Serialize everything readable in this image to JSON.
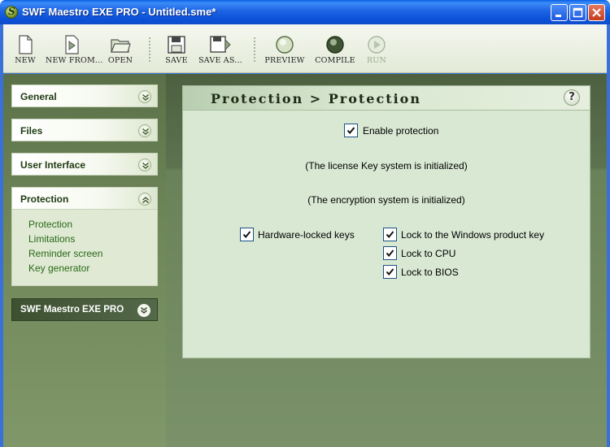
{
  "window": {
    "title": "SWF Maestro EXE PRO - Untitled.sme*",
    "accent": "#0b50d8"
  },
  "toolbar": {
    "new": "NEW",
    "new_from": "NEW FROM...",
    "open": "OPEN",
    "save": "SAVE",
    "save_as": "SAVE AS...",
    "preview": "PREVIEW",
    "compile": "COMPILE",
    "run": "RUN"
  },
  "sidebar": {
    "sections": [
      {
        "label": "General",
        "expanded": false
      },
      {
        "label": "Files",
        "expanded": false
      },
      {
        "label": "User Interface",
        "expanded": false
      },
      {
        "label": "Protection",
        "expanded": true
      }
    ],
    "protection_items": [
      "Protection",
      "Limitations",
      "Reminder screen",
      "Key generator"
    ],
    "brand": "SWF Maestro EXE PRO"
  },
  "panel": {
    "title": "Protection > Protection",
    "help": "?",
    "enable_protection": "Enable protection",
    "license_status": "(The license Key system is initialized)",
    "encryption_status": "(The encryption system is initialized)",
    "hardware_locked": "Hardware-locked keys",
    "lock_windows": "Lock to the Windows product key",
    "lock_cpu": "Lock to CPU",
    "lock_bios": "Lock to BIOS"
  }
}
